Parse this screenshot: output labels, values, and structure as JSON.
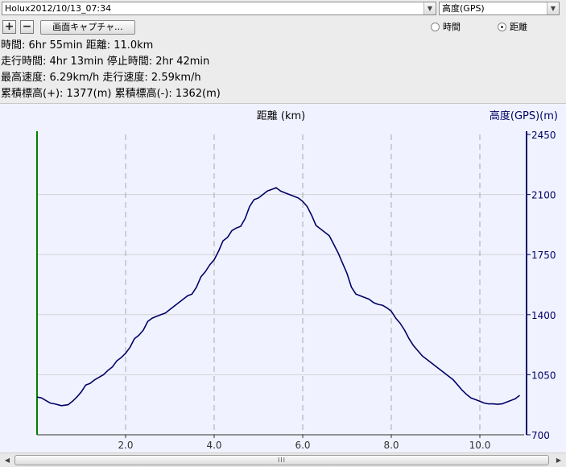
{
  "toolbar": {
    "track_select": {
      "value": "Holux2012/10/13_07:34"
    },
    "altitude_select": {
      "value": "高度(GPS)"
    },
    "zoom_in_label": "+",
    "zoom_out_label": "−",
    "capture_label": "画面キャプチャ...",
    "radio_time_label": "時間",
    "radio_distance_label": "距離",
    "selected_axis": "distance"
  },
  "stats": {
    "line1": "時間: 6hr 55min  距離: 11.0km",
    "line2": "走行時間: 4hr 13min  停止時間: 2hr 42min",
    "line3": "最高速度: 6.29km/h  走行速度: 2.59km/h",
    "line4": "累積標高(+): 1377(m)  累積標高(-): 1362(m)"
  },
  "scrollbar": {
    "grip": "III"
  },
  "chart_data": {
    "type": "line",
    "title": "",
    "xlabel": "距離 (km)",
    "ylabel": "高度(GPS)(m)",
    "xlim": [
      0,
      11.0
    ],
    "ylim": [
      700,
      2450
    ],
    "xticks": [
      2.0,
      4.0,
      6.0,
      8.0,
      10.0
    ],
    "xtick_labels": [
      "2.0",
      "4.0",
      "6.0",
      "8.0",
      "10.0"
    ],
    "yticks": [
      700,
      1050,
      1400,
      1750,
      2100,
      2450
    ],
    "ytick_labels": [
      "700",
      "1050",
      "1400",
      "1750",
      "2100",
      "2450"
    ],
    "grid": {
      "vertical": true,
      "horizontal": true
    },
    "colors": {
      "line": "#000066",
      "left_axis": "#008000",
      "grid": "#c8c8c8",
      "background": "#f0f3ff"
    },
    "series": [
      {
        "x": [
          0.0,
          0.1,
          0.2,
          0.3,
          0.4,
          0.55,
          0.7,
          0.8,
          0.9,
          1.0,
          1.1,
          1.2,
          1.3,
          1.4,
          1.5,
          1.6,
          1.7,
          1.8,
          1.9,
          2.0,
          2.1,
          2.2,
          2.3,
          2.4,
          2.5,
          2.6,
          2.7,
          2.8,
          2.9,
          3.0,
          3.1,
          3.2,
          3.3,
          3.4,
          3.5,
          3.6,
          3.7,
          3.8,
          3.9,
          4.0,
          4.1,
          4.2,
          4.3,
          4.4,
          4.5,
          4.6,
          4.7,
          4.8,
          4.9,
          5.0,
          5.1,
          5.2,
          5.3,
          5.4,
          5.5,
          5.6,
          5.7,
          5.8,
          5.9,
          6.0,
          6.1,
          6.2,
          6.3,
          6.4,
          6.5,
          6.6,
          6.7,
          6.8,
          6.9,
          7.0,
          7.1,
          7.2,
          7.3,
          7.4,
          7.5,
          7.6,
          7.7,
          7.8,
          7.9,
          8.0,
          8.1,
          8.2,
          8.3,
          8.4,
          8.5,
          8.6,
          8.7,
          8.8,
          8.9,
          9.0,
          9.1,
          9.2,
          9.3,
          9.4,
          9.5,
          9.6,
          9.7,
          9.8,
          9.9,
          10.0,
          10.1,
          10.2,
          10.3,
          10.4,
          10.5,
          10.6,
          10.7,
          10.8,
          10.9
        ],
        "y": [
          920,
          915,
          900,
          885,
          880,
          870,
          875,
          895,
          920,
          950,
          990,
          1000,
          1020,
          1035,
          1050,
          1075,
          1095,
          1130,
          1150,
          1175,
          1210,
          1260,
          1280,
          1310,
          1360,
          1380,
          1390,
          1400,
          1410,
          1430,
          1450,
          1470,
          1490,
          1510,
          1520,
          1560,
          1620,
          1650,
          1690,
          1720,
          1770,
          1830,
          1850,
          1890,
          1905,
          1915,
          1960,
          2030,
          2070,
          2080,
          2100,
          2120,
          2130,
          2140,
          2120,
          2110,
          2100,
          2090,
          2080,
          2060,
          2030,
          1980,
          1920,
          1900,
          1880,
          1860,
          1810,
          1760,
          1700,
          1640,
          1560,
          1520,
          1510,
          1500,
          1490,
          1470,
          1460,
          1455,
          1440,
          1420,
          1380,
          1350,
          1310,
          1260,
          1220,
          1190,
          1160,
          1140,
          1120,
          1100,
          1080,
          1060,
          1040,
          1020,
          990,
          960,
          935,
          915,
          905,
          895,
          885,
          880,
          880,
          878,
          880,
          890,
          900,
          910,
          930
        ]
      }
    ]
  }
}
